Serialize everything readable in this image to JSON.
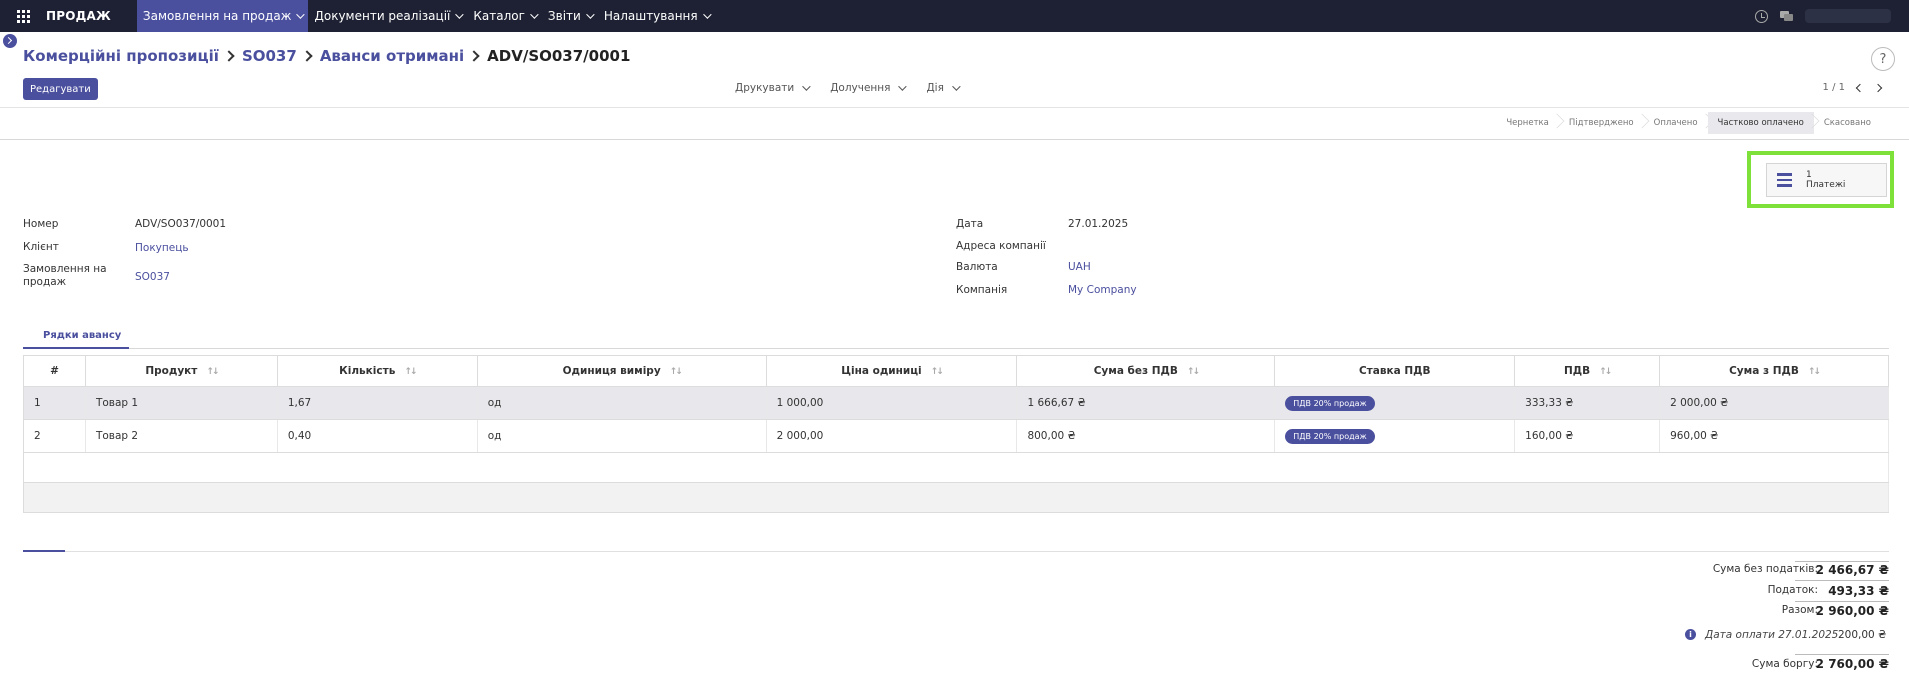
{
  "nav": {
    "app_name": "ПРОДАЖ",
    "menu": [
      {
        "label": "Замовлення на продаж"
      },
      {
        "label": "Документи реалізації"
      },
      {
        "label": "Каталог"
      },
      {
        "label": "Звіти"
      },
      {
        "label": "Налаштування"
      }
    ]
  },
  "breadcrumb": {
    "items": [
      "Комерційні пропозиції",
      "SO037",
      "Аванси отримані"
    ],
    "current": "ADV/SO037/0001"
  },
  "help_icon": "?",
  "toolbar": {
    "edit_label": "Редагувати",
    "actions": [
      "Друкувати",
      "Долучення",
      "Дія"
    ],
    "pager": "1 / 1"
  },
  "statusbar": {
    "stages": [
      "Чернетка",
      "Підтверджено",
      "Оплачено",
      "Частково оплачено",
      "Скасовано"
    ],
    "active_index": 3
  },
  "smart_button": {
    "count": "1",
    "label": "Платежі"
  },
  "fields": {
    "left": [
      {
        "label": "Номер",
        "value": "ADV/SO037/0001"
      },
      {
        "label": "Клієнт",
        "value": "Покупець"
      },
      {
        "label": "Замовлення на продаж",
        "value": "SO037"
      }
    ],
    "right": [
      {
        "label": "Дата",
        "value": "27.01.2025"
      },
      {
        "label": "Адреса компанії",
        "value": ""
      },
      {
        "label": "Валюта",
        "value": "UAH"
      },
      {
        "label": "Компанія",
        "value": "My Company"
      }
    ]
  },
  "tab": {
    "label": "Рядки авансу"
  },
  "table": {
    "headers": [
      "#",
      "Продукт",
      "Кількість",
      "Одиниця виміру",
      "Ціна одиниці",
      "Сума без ПДВ",
      "Ставка ПДВ",
      "ПДВ",
      "Сума з ПДВ"
    ],
    "rows": [
      {
        "n": "1",
        "product": "Товар 1",
        "qty": "1,67",
        "uom": "од",
        "price": "1 000,00",
        "subtotal": "1 666,67 ₴",
        "tax": "ПДВ 20% продаж",
        "vat": "333,33 ₴",
        "total": "2 000,00 ₴"
      },
      {
        "n": "2",
        "product": "Товар 2",
        "qty": "0,40",
        "uom": "од",
        "price": "2 000,00",
        "subtotal": "800,00 ₴",
        "tax": "ПДВ 20% продаж",
        "vat": "160,00 ₴",
        "total": "960,00 ₴"
      }
    ]
  },
  "totals": {
    "untaxed_label": "Сума без податків:",
    "untaxed": "2 466,67 ₴",
    "tax_label": "Податок:",
    "tax": "493,33 ₴",
    "total_label": "Разом:",
    "total": "2 960,00 ₴",
    "payment_note": "Дата оплати 27.01.2025",
    "payment_amount": "200,00 ₴",
    "due_label": "Сума боргу:",
    "due": "2 760,00 ₴"
  }
}
